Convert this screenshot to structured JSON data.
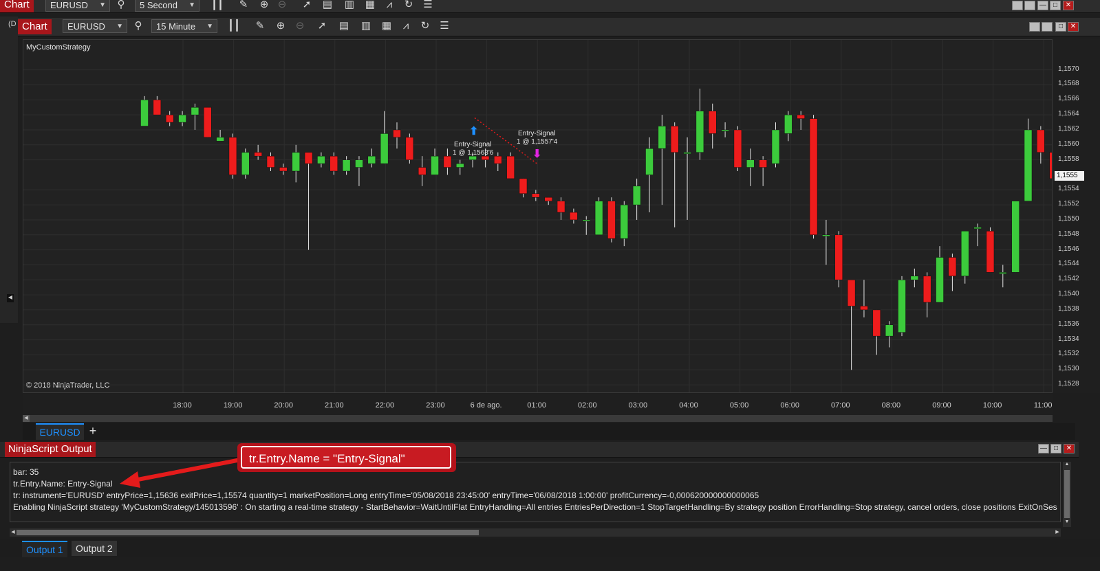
{
  "colors": {
    "accent_red": "#a8161b",
    "up_candle": "#3ccb3c",
    "down_candle": "#ee1c1c",
    "chart_bg": "#222222",
    "tab_blue": "#1e90ff"
  },
  "top_toolbar": {
    "chart_tab": "Chart",
    "instrument": "EURUSD",
    "interval": "5 Second"
  },
  "main_toolbar": {
    "left_stub": "(D",
    "chart_tab": "Chart",
    "instrument": "EURUSD",
    "interval": "15 Minute"
  },
  "chart": {
    "strategy_label": "MyCustomStrategy",
    "copyright": "© 2018 NinjaTrader, LLC",
    "entry_signal_label": "Entry-Signal",
    "entry_signal_price": "1 @ 1,1563'6",
    "exit_signal_label": "Entry-Signal",
    "exit_signal_price": "1 @ 1,1557'4",
    "current_price": "1,1555"
  },
  "chart_data": {
    "type": "candlestick",
    "x_tick_labels": [
      "18:00",
      "19:00",
      "20:00",
      "21:00",
      "22:00",
      "23:00",
      "6 de ago.",
      "01:00",
      "02:00",
      "03:00",
      "04:00",
      "05:00",
      "06:00",
      "07:00",
      "08:00",
      "09:00",
      "10:00",
      "11:00"
    ],
    "y_tick_labels": [
      "1,1570",
      "1,1568",
      "1,1566",
      "1,1564",
      "1,1562",
      "1,1560",
      "1,1558",
      "1,1554",
      "1,1552",
      "1,1550",
      "1,1548",
      "1,1546",
      "1,1544",
      "1,1542",
      "1,1540",
      "1,1538",
      "1,1536",
      "1,1534",
      "1,1532",
      "1,1530",
      "1,1528"
    ],
    "ylim": [
      1.1527,
      1.1574
    ],
    "candles": [
      {
        "o": 1.15625,
        "c": 1.1566,
        "h": 1.15665,
        "l": 1.15625
      },
      {
        "o": 1.1566,
        "c": 1.1564,
        "h": 1.15665,
        "l": 1.1564
      },
      {
        "o": 1.1564,
        "c": 1.1563,
        "h": 1.15645,
        "l": 1.15625
      },
      {
        "o": 1.1563,
        "c": 1.1564,
        "h": 1.15645,
        "l": 1.15625
      },
      {
        "o": 1.1564,
        "c": 1.1565,
        "h": 1.15655,
        "l": 1.1562
      },
      {
        "o": 1.1565,
        "c": 1.1561,
        "h": 1.1565,
        "l": 1.1561
      },
      {
        "o": 1.15605,
        "c": 1.1561,
        "h": 1.1562,
        "l": 1.15605
      },
      {
        "o": 1.1561,
        "c": 1.1556,
        "h": 1.15615,
        "l": 1.15555
      },
      {
        "o": 1.1556,
        "c": 1.1559,
        "h": 1.15595,
        "l": 1.15555
      },
      {
        "o": 1.1559,
        "c": 1.15585,
        "h": 1.156,
        "l": 1.1558
      },
      {
        "o": 1.15585,
        "c": 1.1557,
        "h": 1.1559,
        "l": 1.15565
      },
      {
        "o": 1.1557,
        "c": 1.15565,
        "h": 1.15575,
        "l": 1.1556
      },
      {
        "o": 1.15565,
        "c": 1.1559,
        "h": 1.156,
        "l": 1.1555
      },
      {
        "o": 1.1559,
        "c": 1.15575,
        "h": 1.1559,
        "l": 1.1546
      },
      {
        "o": 1.15575,
        "c": 1.15585,
        "h": 1.1559,
        "l": 1.1557
      },
      {
        "o": 1.15585,
        "c": 1.15565,
        "h": 1.1559,
        "l": 1.1556
      },
      {
        "o": 1.15565,
        "c": 1.1558,
        "h": 1.15585,
        "l": 1.1556
      },
      {
        "o": 1.1557,
        "c": 1.1558,
        "h": 1.15585,
        "l": 1.15545
      },
      {
        "o": 1.15575,
        "c": 1.15585,
        "h": 1.15595,
        "l": 1.1557
      },
      {
        "o": 1.15575,
        "c": 1.15615,
        "h": 1.15645,
        "l": 1.15575
      },
      {
        "o": 1.1562,
        "c": 1.1561,
        "h": 1.1563,
        "l": 1.15595
      },
      {
        "o": 1.1561,
        "c": 1.1558,
        "h": 1.15615,
        "l": 1.15575
      },
      {
        "o": 1.1557,
        "c": 1.1556,
        "h": 1.15585,
        "l": 1.15545
      },
      {
        "o": 1.1556,
        "c": 1.15585,
        "h": 1.15595,
        "l": 1.1556
      },
      {
        "o": 1.15585,
        "c": 1.1557,
        "h": 1.15595,
        "l": 1.1556
      },
      {
        "o": 1.1557,
        "c": 1.15575,
        "h": 1.1558,
        "l": 1.1556
      },
      {
        "o": 1.1558,
        "c": 1.15585,
        "h": 1.1559,
        "l": 1.1557
      },
      {
        "o": 1.15585,
        "c": 1.1558,
        "h": 1.15595,
        "l": 1.1557
      },
      {
        "o": 1.15585,
        "c": 1.15575,
        "h": 1.1559,
        "l": 1.15565
      },
      {
        "o": 1.15585,
        "c": 1.15555,
        "h": 1.1559,
        "l": 1.15555
      },
      {
        "o": 1.15555,
        "c": 1.15535,
        "h": 1.15555,
        "l": 1.1553
      },
      {
        "o": 1.15535,
        "c": 1.1553,
        "h": 1.1554,
        "l": 1.15525
      },
      {
        "o": 1.1553,
        "c": 1.15525,
        "h": 1.1553,
        "l": 1.1552
      },
      {
        "o": 1.15525,
        "c": 1.1551,
        "h": 1.1553,
        "l": 1.155
      },
      {
        "o": 1.1551,
        "c": 1.155,
        "h": 1.15515,
        "l": 1.15495
      },
      {
        "o": 1.155,
        "c": 1.155,
        "h": 1.15505,
        "l": 1.1548
      },
      {
        "o": 1.1548,
        "c": 1.15525,
        "h": 1.1553,
        "l": 1.1548
      },
      {
        "o": 1.15525,
        "c": 1.15475,
        "h": 1.1553,
        "l": 1.1547
      },
      {
        "o": 1.15475,
        "c": 1.1552,
        "h": 1.15525,
        "l": 1.15465
      },
      {
        "o": 1.1552,
        "c": 1.15545,
        "h": 1.15555,
        "l": 1.155
      },
      {
        "o": 1.1556,
        "c": 1.15595,
        "h": 1.1561,
        "l": 1.1551
      },
      {
        "o": 1.15595,
        "c": 1.15625,
        "h": 1.1564,
        "l": 1.1552
      },
      {
        "o": 1.15625,
        "c": 1.1559,
        "h": 1.1563,
        "l": 1.1549
      },
      {
        "o": 1.1559,
        "c": 1.1559,
        "h": 1.1561,
        "l": 1.155
      },
      {
        "o": 1.1559,
        "c": 1.15645,
        "h": 1.15675,
        "l": 1.1558
      },
      {
        "o": 1.15645,
        "c": 1.15615,
        "h": 1.15655,
        "l": 1.15595
      },
      {
        "o": 1.1562,
        "c": 1.1562,
        "h": 1.1563,
        "l": 1.1561
      },
      {
        "o": 1.1562,
        "c": 1.1557,
        "h": 1.15625,
        "l": 1.15565
      },
      {
        "o": 1.1557,
        "c": 1.1558,
        "h": 1.15595,
        "l": 1.15545
      },
      {
        "o": 1.1558,
        "c": 1.1557,
        "h": 1.15585,
        "l": 1.15545
      },
      {
        "o": 1.15575,
        "c": 1.1562,
        "h": 1.1563,
        "l": 1.1557
      },
      {
        "o": 1.15615,
        "c": 1.1564,
        "h": 1.15645,
        "l": 1.15605
      },
      {
        "o": 1.1564,
        "c": 1.15635,
        "h": 1.15645,
        "l": 1.1562
      },
      {
        "o": 1.15635,
        "c": 1.1548,
        "h": 1.1564,
        "l": 1.15475
      },
      {
        "o": 1.1548,
        "c": 1.1548,
        "h": 1.155,
        "l": 1.1544
      },
      {
        "o": 1.1548,
        "c": 1.1542,
        "h": 1.15485,
        "l": 1.1541
      },
      {
        "o": 1.1542,
        "c": 1.15385,
        "h": 1.1542,
        "l": 1.153
      },
      {
        "o": 1.15385,
        "c": 1.1538,
        "h": 1.1542,
        "l": 1.1537
      },
      {
        "o": 1.1538,
        "c": 1.15345,
        "h": 1.1538,
        "l": 1.1532
      },
      {
        "o": 1.15345,
        "c": 1.1536,
        "h": 1.15365,
        "l": 1.1533
      },
      {
        "o": 1.1535,
        "c": 1.1542,
        "h": 1.15425,
        "l": 1.15345
      },
      {
        "o": 1.1542,
        "c": 1.15425,
        "h": 1.15435,
        "l": 1.1541
      },
      {
        "o": 1.15425,
        "c": 1.1539,
        "h": 1.1543,
        "l": 1.1537
      },
      {
        "o": 1.1539,
        "c": 1.1545,
        "h": 1.15465,
        "l": 1.1539
      },
      {
        "o": 1.1545,
        "c": 1.15425,
        "h": 1.15455,
        "l": 1.15405
      },
      {
        "o": 1.15425,
        "c": 1.15485,
        "h": 1.15485,
        "l": 1.15415
      },
      {
        "o": 1.1549,
        "c": 1.1549,
        "h": 1.15495,
        "l": 1.15465
      },
      {
        "o": 1.15485,
        "c": 1.1543,
        "h": 1.1549,
        "l": 1.1543
      },
      {
        "o": 1.1543,
        "c": 1.1543,
        "h": 1.1544,
        "l": 1.1541
      },
      {
        "o": 1.1543,
        "c": 1.15525,
        "h": 1.15525,
        "l": 1.1543
      },
      {
        "o": 1.15525,
        "c": 1.1562,
        "h": 1.15635,
        "l": 1.15525
      },
      {
        "o": 1.1562,
        "c": 1.1559,
        "h": 1.15625,
        "l": 1.15575
      },
      {
        "o": 1.1559,
        "c": 1.15555,
        "h": 1.1559,
        "l": 1.1554
      }
    ]
  },
  "instrument_tabs": {
    "active": "EURUSD",
    "add": "+"
  },
  "output": {
    "title": "NinjaScript Output",
    "lines": [
      "bar: 35",
      "tr.Entry.Name:   Entry-Signal",
      "tr: instrument='EURUSD' entryPrice=1,15636 exitPrice=1,15574 quantity=1 marketPosition=Long entryTime='05/08/2018 23:45:00' entryTime='06/08/2018 1:00:00' profitCurrency=-0,000620000000000065",
      "Enabling NinjaScript strategy 'MyCustomStrategy/145013596' : On starting a real-time strategy - StartBehavior=WaitUntilFlat EntryHandling=All entries EntriesPerDirection=1 StopTargetHandling=By strategy position ErrorHandling=Stop strategy, cancel orders, close positions ExitOnSes"
    ],
    "tabs": [
      "Output 1",
      "Output 2"
    ]
  },
  "callout": {
    "text": "tr.Entry.Name = \"Entry-Signal\""
  },
  "icons": [
    "search-icon",
    "bars-icon",
    "pencil-icon",
    "zoom-in-icon",
    "zoom-out-icon",
    "cursor-icon",
    "properties-icon",
    "strategies-icon",
    "indicators-icon",
    "drawing-tools-icon",
    "refresh-icon",
    "list-icon"
  ]
}
